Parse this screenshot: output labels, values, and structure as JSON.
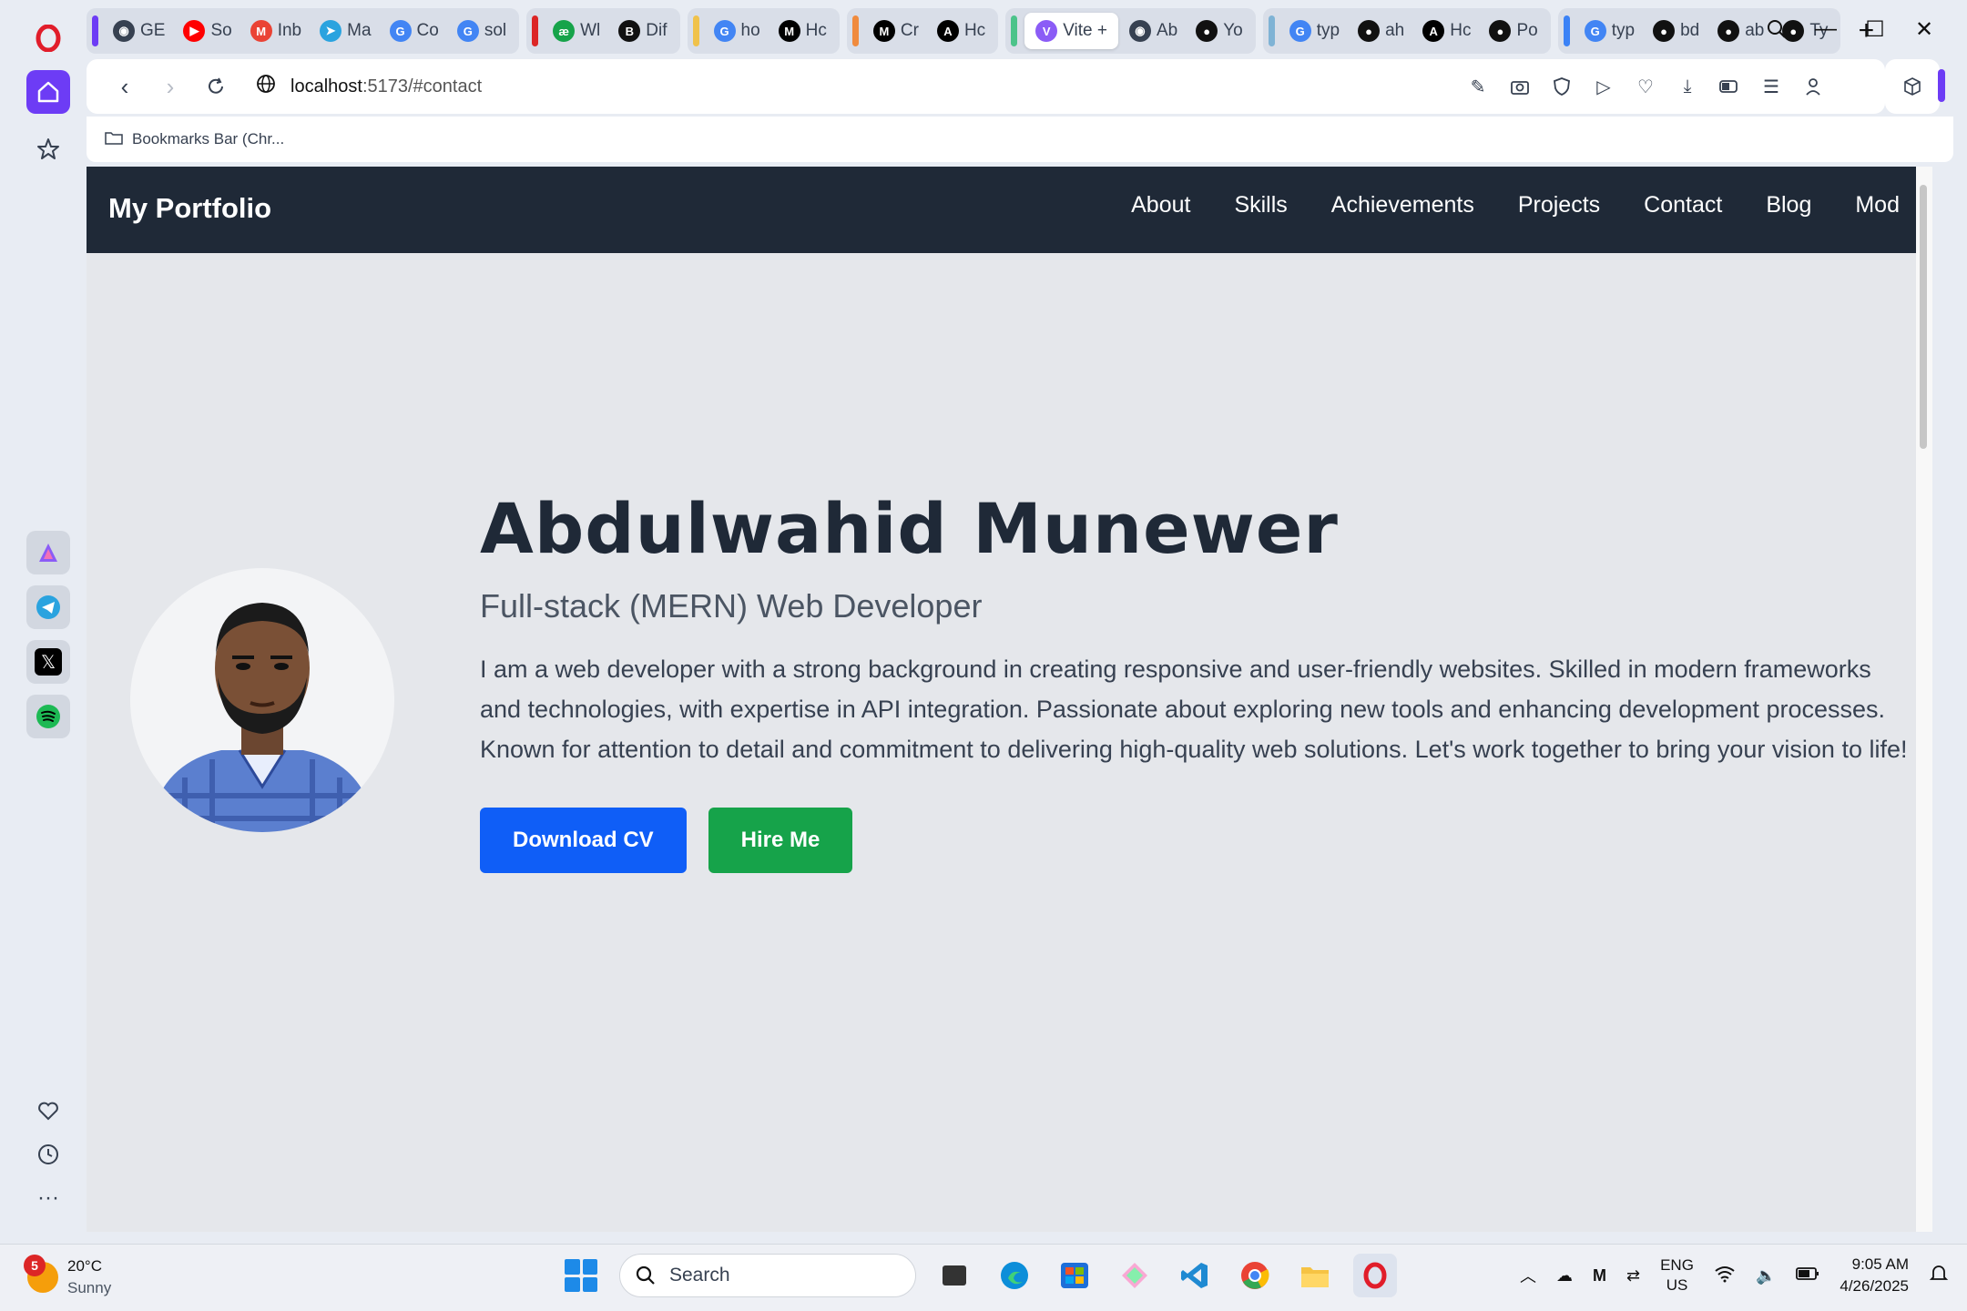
{
  "browser": {
    "tabs": [
      {
        "label": "GE",
        "group": 0
      },
      {
        "label": "So",
        "group": 0
      },
      {
        "label": "Inb",
        "group": 0
      },
      {
        "label": "Ma",
        "group": 0
      },
      {
        "label": "Co",
        "group": 0
      },
      {
        "label": "sol",
        "group": 0
      },
      {
        "label": "Wl",
        "group": 1
      },
      {
        "label": "Dif",
        "group": 1
      },
      {
        "label": "ho",
        "group": 2
      },
      {
        "label": "Hc",
        "group": 2
      },
      {
        "label": "Cr",
        "group": 3
      },
      {
        "label": "Hc",
        "group": 3
      },
      {
        "label": "Vite +",
        "group": 4,
        "active": true
      },
      {
        "label": "Ab",
        "group": 4
      },
      {
        "label": "Yo",
        "group": 4
      },
      {
        "label": "typ",
        "group": 5
      },
      {
        "label": "ah",
        "group": 5
      },
      {
        "label": "Hc",
        "group": 5
      },
      {
        "label": "Po",
        "group": 5
      },
      {
        "label": "typ",
        "group": 6
      },
      {
        "label": "bd",
        "group": 6
      },
      {
        "label": "ab",
        "group": 6
      },
      {
        "label": "Ty",
        "group": 6
      }
    ],
    "url_host": "localhost",
    "url_path": ":5173/#contact",
    "bookmarks_label": "Bookmarks Bar (Chr..."
  },
  "site": {
    "brand": "My Portfolio",
    "nav": [
      "About",
      "Skills",
      "Achievements",
      "Projects",
      "Contact",
      "Blog",
      "Mod"
    ],
    "name": "Abdulwahid Munewer",
    "role": "Full-stack (MERN) Web Developer",
    "bio": "I am a web developer with a strong background in creating responsive and user-friendly websites. Skilled in modern frameworks and technologies, with expertise in API integration. Passionate about exploring new tools and enhancing development processes. Known for attention to detail and commitment to delivering high-quality web solutions. Let's work together to bring your vision to life!",
    "download_cv": "Download CV",
    "hire_me": "Hire Me"
  },
  "taskbar": {
    "weather_temp": "20°C",
    "weather_desc": "Sunny",
    "weather_badge": "5",
    "search_placeholder": "Search",
    "lang_line1": "ENG",
    "lang_line2": "US",
    "time": "9:05 AM",
    "date": "4/26/2025"
  },
  "colors": {
    "nav_bg": "#1f2937",
    "download_btn": "#0f5ef7",
    "hire_btn": "#16a34a",
    "opera_accent": "#6d3cf5"
  }
}
